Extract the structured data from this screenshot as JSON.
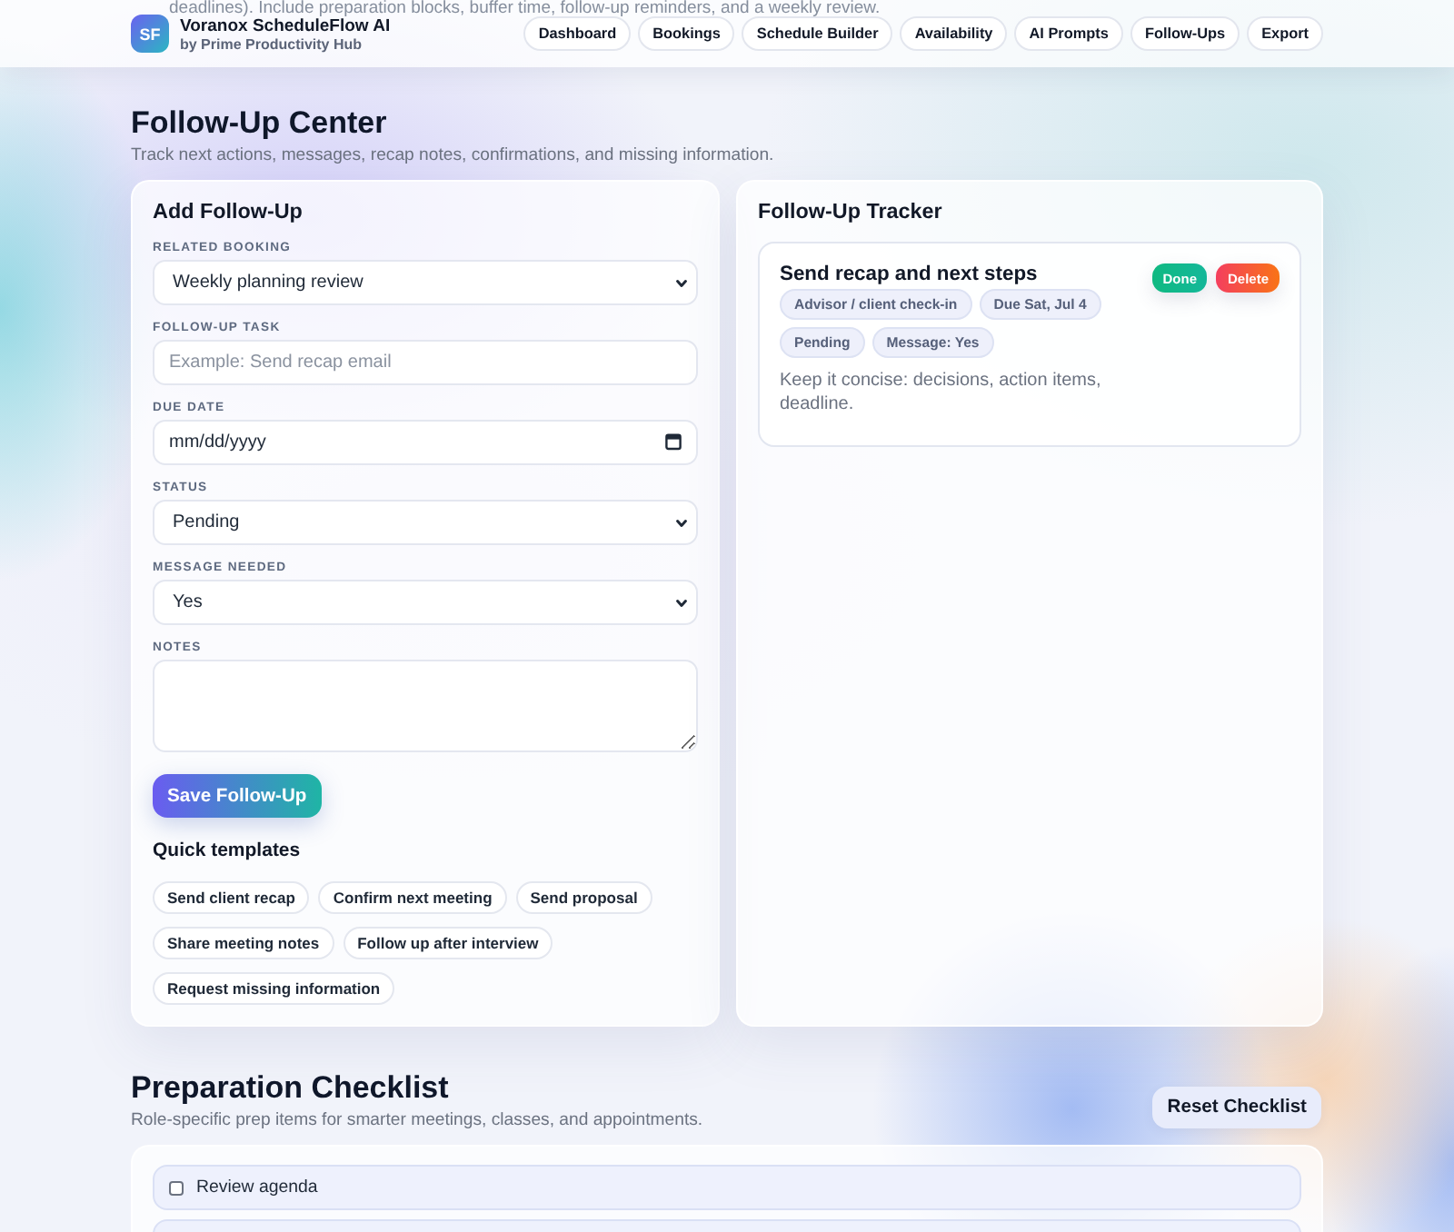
{
  "backdrop_text": "deadlines). Include preparation blocks, buffer time, follow-up reminders, and a weekly review.",
  "header": {
    "logo": "SF",
    "title": "Voranox ScheduleFlow AI",
    "subtitle": "by Prime Productivity Hub",
    "nav": [
      "Dashboard",
      "Bookings",
      "Schedule Builder",
      "Availability",
      "AI Prompts",
      "Follow-Ups",
      "Export"
    ]
  },
  "page": {
    "title": "Follow-Up Center",
    "subtitle": "Track next actions, messages, recap notes, confirmations, and missing information."
  },
  "add_form": {
    "title": "Add Follow-Up",
    "fields": [
      {
        "kind": "select",
        "label": "RELATED BOOKING",
        "value": "Weekly planning review"
      },
      {
        "kind": "text",
        "label": "FOLLOW-UP TASK",
        "placeholder": "Example: Send recap email"
      },
      {
        "kind": "date",
        "label": "DUE DATE",
        "placeholder": "mm/dd/yyyy"
      },
      {
        "kind": "select",
        "label": "STATUS",
        "value": "Pending"
      },
      {
        "kind": "select",
        "label": "MESSAGE NEEDED",
        "value": "Yes"
      },
      {
        "kind": "textarea",
        "label": "NOTES"
      }
    ],
    "save_button": "Save Follow-Up",
    "templates_title": "Quick templates",
    "templates": [
      "Send client recap",
      "Confirm next meeting",
      "Send proposal",
      "Share meeting notes",
      "Follow up after interview",
      "Request missing information"
    ]
  },
  "tracker": {
    "title": "Follow-Up Tracker",
    "items": [
      {
        "title": "Send recap and next steps",
        "tags": [
          "Advisor / client check-in",
          "Due Sat, Jul 4",
          "Pending",
          "Message: Yes"
        ],
        "note": "Keep it concise: decisions, action items, deadline.",
        "actions": [
          {
            "kind": "done",
            "label": "Done"
          },
          {
            "kind": "delete",
            "label": "Delete"
          }
        ]
      }
    ]
  },
  "checklist": {
    "title": "Preparation Checklist",
    "subtitle": "Role-specific prep items for smarter meetings, classes, and appointments.",
    "reset_button": "Reset Checklist",
    "items": [
      {
        "label": "Review agenda",
        "checked": false
      }
    ]
  }
}
